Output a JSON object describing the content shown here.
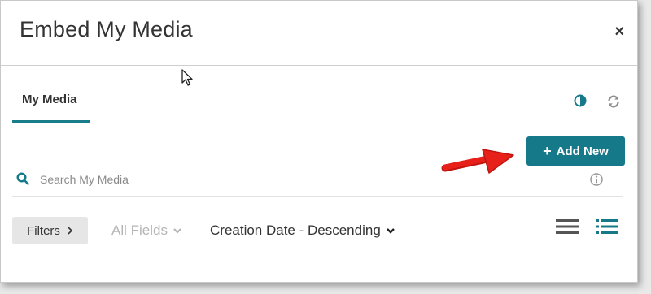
{
  "dialog": {
    "title": "Embed My Media",
    "close_label": "×"
  },
  "tabs": [
    {
      "label": "My Media",
      "active": true
    }
  ],
  "toolbar": {
    "add_new_label": "Add New",
    "add_new_icon": "+"
  },
  "search": {
    "placeholder": "Search My Media",
    "value": ""
  },
  "filters": {
    "filters_label": "Filters",
    "fields_label": "All Fields",
    "sort_label": "Creation Date - Descending"
  },
  "icons": {
    "contrast": "contrast-icon",
    "refresh": "refresh-icon",
    "search": "search-icon",
    "info": "info-icon",
    "list_view": "list-view-icon",
    "detail_view": "detail-view-icon"
  },
  "colors": {
    "accent": "#16798a",
    "arrow": "#e8201a",
    "muted_text": "#b5b5b5"
  }
}
